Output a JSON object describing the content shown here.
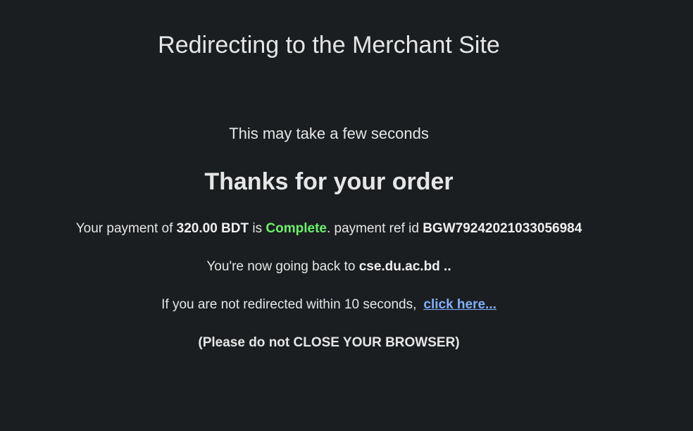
{
  "title": "Redirecting to the Merchant Site",
  "subtitle": "This may take a few seconds",
  "thanks": "Thanks for your order",
  "payment": {
    "prefix": "Your payment of ",
    "amount": "320.00 BDT",
    "is": " is ",
    "status": "Complete",
    "after_status": ". payment ref id ",
    "ref_id": "BGW79242021033056984",
    "status_color": "#6bf06b"
  },
  "going_back": {
    "prefix": "You're now going back to ",
    "site": "cse.du.ac.bd ..",
    "site_suffix": ""
  },
  "redirect": {
    "text": "If you are not redirected within 10 seconds,",
    "link_label": "click here...",
    "link_color": "#7fb0ff"
  },
  "warning": "(Please do not CLOSE YOUR BROWSER)",
  "background_color": "#1b1e20"
}
